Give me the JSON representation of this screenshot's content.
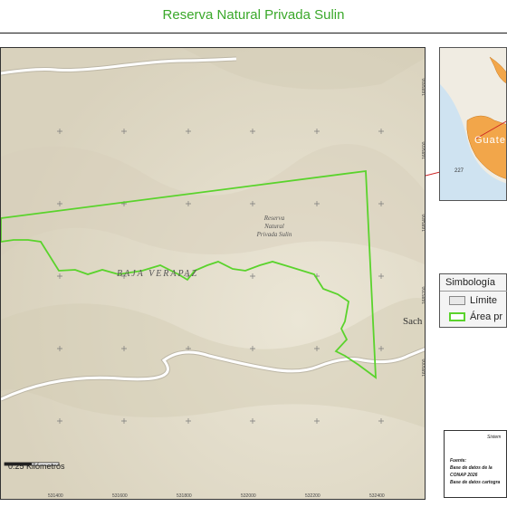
{
  "title": "Reserva Natural Privada Sulin",
  "map": {
    "reserve_label": [
      "Reserva",
      "Natural",
      "Privada Sulin"
    ],
    "region_label": "BAJA VERAPAZ",
    "town_label": "Sach",
    "scale_label": "0.25 Kilómetros",
    "x_ticks": [
      "531400",
      "531600",
      "531800",
      "532000",
      "532200",
      "532400"
    ],
    "y_ticks": [
      "1685800",
      "1685600",
      "1685400",
      "1685200",
      "1685000"
    ],
    "colors": {
      "terrain": "#e3ddcc",
      "reserve_outline": "#5ad32c",
      "road": "#ffffff"
    }
  },
  "inset": {
    "label": "Guate",
    "number_label": "227",
    "colors": {
      "water": "#cfe3f1",
      "country": "#f2a64a",
      "land": "#f0ece2"
    }
  },
  "legend": {
    "title": "Simbología",
    "items": [
      {
        "label": "Límite",
        "swatch": "limite"
      },
      {
        "label": "Área pr",
        "swatch": "area"
      }
    ]
  },
  "info": {
    "heading": "Sistem",
    "lines": [
      "Fuente:",
      "Base de datos de la",
      "CONAP 2026",
      "Base de datos cartogra"
    ]
  }
}
